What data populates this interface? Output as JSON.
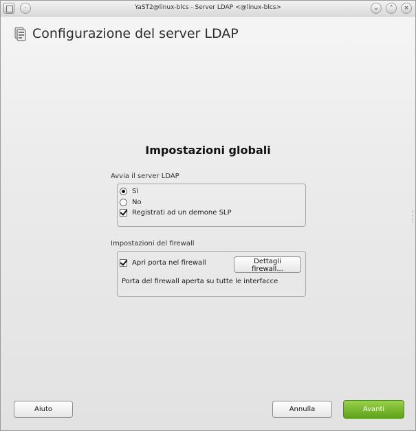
{
  "window": {
    "title": "YaST2@linux-blcs - Server LDAP <@linux-blcs>"
  },
  "header": {
    "title": "Configurazione del server LDAP"
  },
  "main": {
    "section_title": "Impostazioni globali",
    "ldap_group": {
      "label": "Avvia il server LDAP",
      "radio_yes": "Sì",
      "radio_no": "No",
      "selected": "Sì",
      "slp_checkbox": "Registrati ad un demone SLP",
      "slp_checked": true
    },
    "firewall_group": {
      "label": "Impostazioni del firewall",
      "open_port_checkbox": "Apri porta nel firewall",
      "open_port_checked": true,
      "details_button": "Dettagli firewall...",
      "status_text": "Porta del firewall aperta su tutte le interfacce"
    }
  },
  "footer": {
    "help_button": "Aiuto",
    "cancel_button": "Annulla",
    "next_button": "Avanti"
  },
  "colors": {
    "primary_button": "#5ea21b",
    "background": "#ececec"
  },
  "icons": [
    "app-icon",
    "menu-icon",
    "minimize-icon",
    "maximize-icon",
    "close-icon",
    "ldap-server-icon"
  ]
}
